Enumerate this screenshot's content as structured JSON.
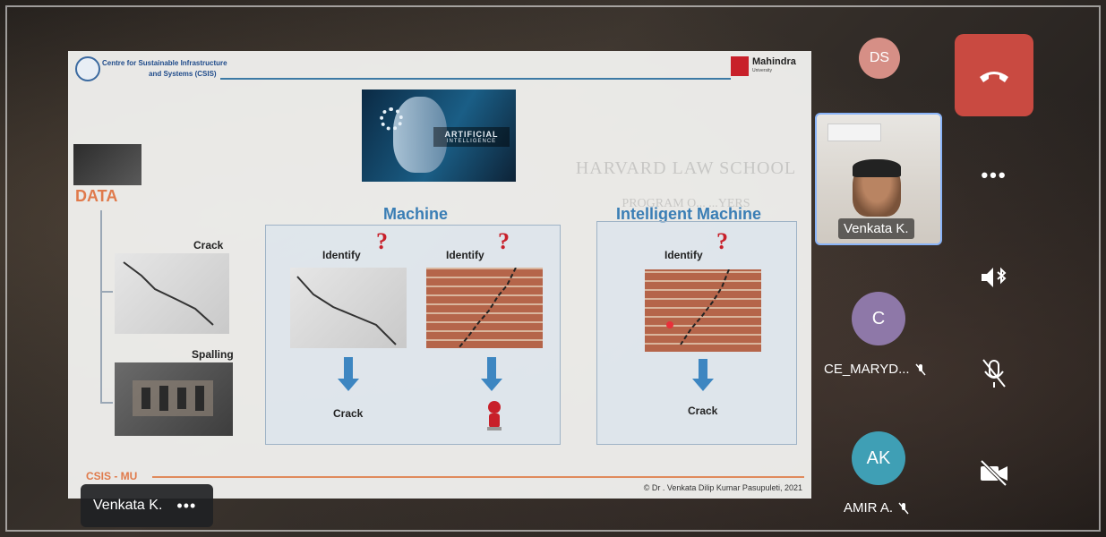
{
  "slide": {
    "header_line1": "Centre for Sustainable Infrastructure",
    "header_line2": "and Systems (CSIS)",
    "logo_name": "Mahindra",
    "logo_sub": "University",
    "ai_label": "ARTIFICIAL",
    "ai_sublabel": "INTELLIGENCE",
    "data_label": "DATA",
    "crack_label": "Crack",
    "spalling_label": "Spalling",
    "machine_title": "Machine",
    "intelligent_title": "Intelligent Machine",
    "identify_1": "Identify",
    "identify_2": "Identify",
    "identify_3": "Identify",
    "qmark": "?",
    "result_1": "Crack",
    "result_3": "Crack",
    "footer_left": "CSIS - MU",
    "credit": "© Dr . Venkata Dilip Kumar Pasupuleti, 2021",
    "watermark_1": "HARVARD LAW SCHOOL",
    "watermark_2": "PROGRAM O... ...YERS"
  },
  "presenter_chip": {
    "name": "Venkata K.",
    "more": "•••"
  },
  "participants": [
    {
      "initials": "DS",
      "color": "#d68f86"
    },
    {
      "name": "Venkata K.",
      "video": true
    },
    {
      "initials": "C",
      "name": "CE_MARYD...",
      "color": "#8e78a8",
      "muted": true
    },
    {
      "initials": "AK",
      "name": "AMIR A.",
      "color": "#3f9fb5",
      "muted": true
    }
  ],
  "controls": {
    "end_call": "end-call",
    "more": "•••",
    "speaker": "bluetooth-speaker",
    "mic": "mic-off",
    "camera": "camera-off"
  },
  "colors": {
    "end_call": "#c94a41",
    "accent_blue": "#3a7eb5",
    "accent_orange": "#e07a4b"
  }
}
